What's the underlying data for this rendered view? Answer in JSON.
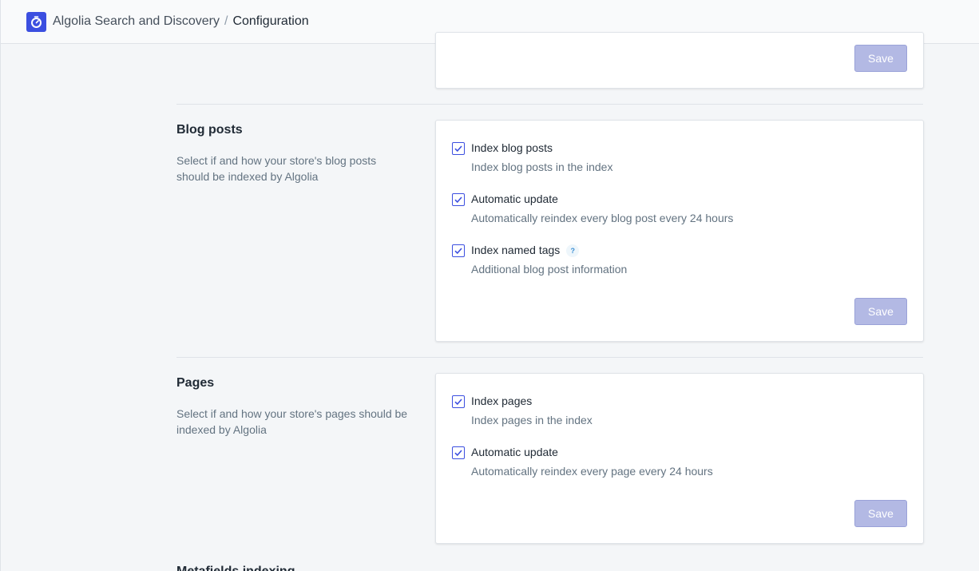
{
  "header": {
    "app_name": "Algolia Search and Discovery",
    "separator": "/",
    "page": "Configuration"
  },
  "top_card": {
    "save_label": "Save"
  },
  "blog_posts": {
    "title": "Blog posts",
    "description": "Select if and how your store's blog posts should be indexed by Algolia",
    "options": [
      {
        "label": "Index blog posts",
        "help": "Index blog posts in the index",
        "checked": true
      },
      {
        "label": "Automatic update",
        "help": "Automatically reindex every blog post every 24 hours",
        "checked": true
      },
      {
        "label": "Index named tags",
        "help": "Additional blog post information",
        "checked": true,
        "tooltip_icon": "?"
      }
    ],
    "save_label": "Save"
  },
  "pages": {
    "title": "Pages",
    "description": "Select if and how your store's pages should be indexed by Algolia",
    "options": [
      {
        "label": "Index pages",
        "help": "Index pages in the index",
        "checked": true
      },
      {
        "label": "Automatic update",
        "help": "Automatically reindex every page every 24 hours",
        "checked": true
      }
    ],
    "save_label": "Save"
  },
  "next_section": {
    "title": "Metafields indexing"
  },
  "colors": {
    "accent": "#3c4fe0",
    "disabled_button": "#b3b9e4",
    "background": "#f4f6f8"
  },
  "icons": {
    "app": "algolia-stopwatch-icon",
    "checkbox": "checkmark-icon"
  }
}
